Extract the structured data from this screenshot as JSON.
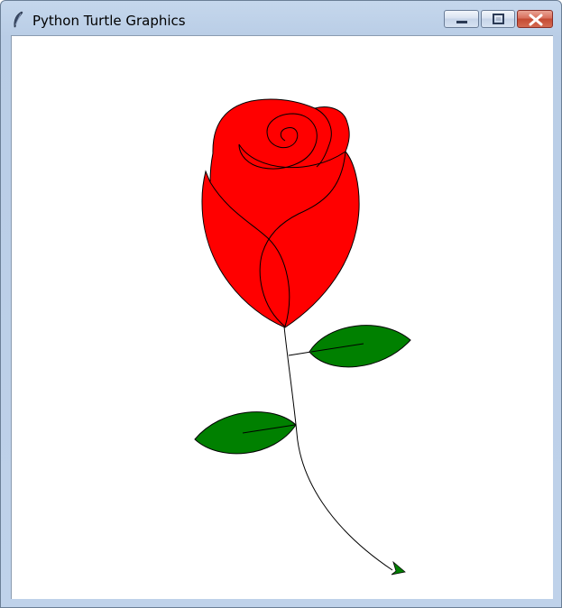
{
  "window": {
    "title": "Python Turtle Graphics",
    "icon": "feather-icon",
    "controls": {
      "minimize_icon": "minimize-icon",
      "maximize_icon": "maximize-icon",
      "close_icon": "close-icon"
    }
  },
  "canvas": {
    "background": "#ffffff",
    "drawing": "rose",
    "colors": {
      "petal_fill": "#ff0000",
      "leaf_fill": "#008000",
      "outline": "#000000",
      "turtle_cursor": "#008000"
    }
  }
}
